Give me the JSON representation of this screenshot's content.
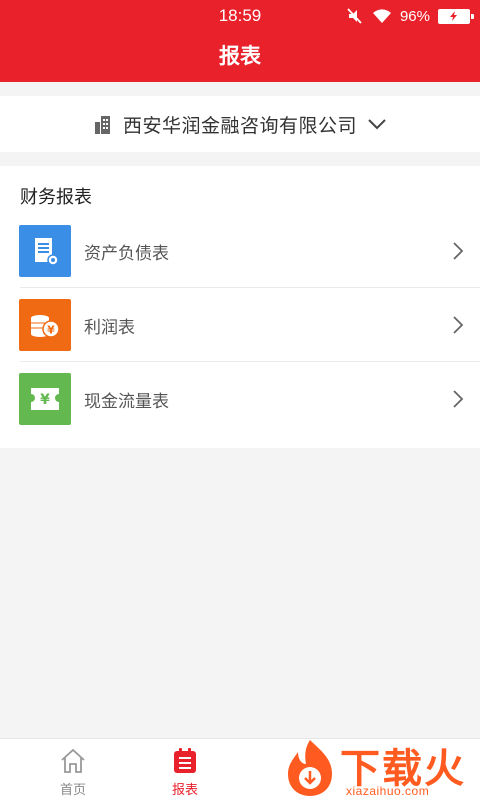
{
  "status_bar": {
    "time": "18:59",
    "battery": "96%"
  },
  "header": {
    "title": "报表"
  },
  "company": {
    "name": "西安华润金融咨询有限公司"
  },
  "financial": {
    "section_title": "财务报表",
    "items": [
      {
        "label": "资产负债表",
        "color": "#3a8ee6",
        "icon": "document-icon"
      },
      {
        "label": "利润表",
        "color": "#ef6a12",
        "icon": "coins-icon"
      },
      {
        "label": "现金流量表",
        "color": "#63b94f",
        "icon": "cash-icon"
      }
    ]
  },
  "bottom_nav": [
    {
      "label": "首页",
      "icon": "home-icon"
    },
    {
      "label": "报表",
      "icon": "report-icon",
      "active": true
    }
  ],
  "watermark": {
    "text": "下载火",
    "url": "xiazaihuo.com"
  },
  "colors": {
    "brand_red": "#e8212b",
    "background": "#f4f4f4"
  }
}
